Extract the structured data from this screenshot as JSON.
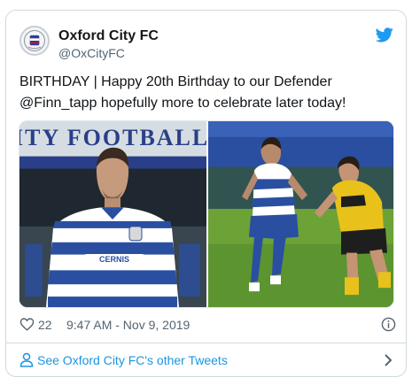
{
  "tweet": {
    "author_name": "Oxford City FC",
    "author_handle": "@OxCityFC",
    "text": "BIRTHDAY | Happy 20th Birthday to our Defender @Finn_tapp hopefully more to celebrate later today!",
    "likes": "22",
    "timestamp": "9:47 AM - Nov 9, 2019",
    "more_tweets_label": "See Oxford City FC's other Tweets"
  },
  "photos": {
    "left_banner_text": "ITY FOOTBALL",
    "left_sponsor_text": "CERNIS"
  },
  "icons": {
    "bird": "twitter-bird-icon",
    "heart": "heart-icon",
    "info": "info-icon",
    "person": "person-icon",
    "chevron": "chevron-right-icon"
  },
  "colors": {
    "twitter_blue": "#1d9bf0",
    "link_blue": "#1b95e0",
    "muted_text": "#536471",
    "border": "#cfd9de"
  }
}
